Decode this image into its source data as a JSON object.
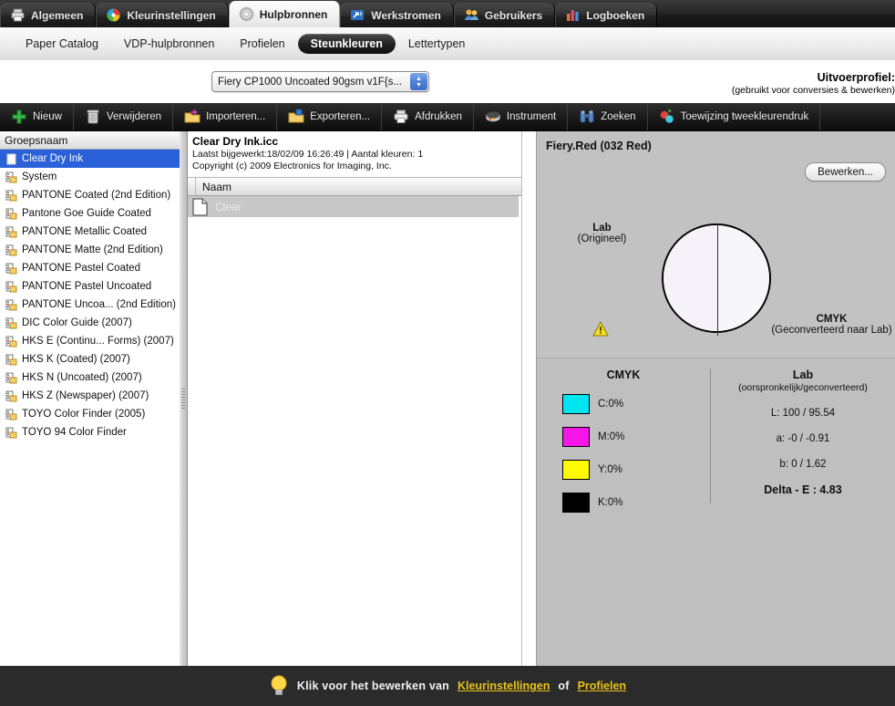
{
  "tabs": [
    {
      "label": "Algemeen",
      "icon": "printer-icon",
      "active": false
    },
    {
      "label": "Kleurinstellingen",
      "icon": "color-wheel-icon",
      "active": false
    },
    {
      "label": "Hulpbronnen",
      "icon": "gear-icon",
      "active": true
    },
    {
      "label": "Werkstromen",
      "icon": "workflow-icon",
      "active": false
    },
    {
      "label": "Gebruikers",
      "icon": "users-icon",
      "active": false
    },
    {
      "label": "Logboeken",
      "icon": "chart-bars-icon",
      "active": false
    }
  ],
  "subtabs": [
    {
      "label": "Paper Catalog",
      "active": false
    },
    {
      "label": "VDP-hulpbronnen",
      "active": false
    },
    {
      "label": "Profielen",
      "active": false
    },
    {
      "label": "Steunkleuren",
      "active": true
    },
    {
      "label": "Lettertypen",
      "active": false
    }
  ],
  "profile": {
    "label": "Uitvoerprofiel:",
    "sublabel": "(gebruikt voor conversies & bewerken)",
    "value": "Fiery CP1000 Uncoated 90gsm v1F{s..."
  },
  "toolbar": [
    {
      "label": "Nieuw",
      "icon": "plus-icon"
    },
    {
      "label": "Verwijderen",
      "icon": "trash-icon"
    },
    {
      "label": "Importeren...",
      "icon": "import-folder-icon"
    },
    {
      "label": "Exporteren...",
      "icon": "export-folder-icon"
    },
    {
      "label": "Afdrukken",
      "icon": "printer-icon"
    },
    {
      "label": "Instrument",
      "icon": "instrument-icon"
    },
    {
      "label": "Zoeken",
      "icon": "binoculars-icon"
    },
    {
      "label": "Toewijzing tweekleurendruk",
      "icon": "two-color-icon"
    }
  ],
  "sidebar": {
    "header": "Groepsnaam",
    "items": [
      {
        "label": "Clear Dry Ink",
        "icon": "swatch-icon",
        "selected": true
      },
      {
        "label": "System",
        "icon": "group-icon",
        "selected": false
      },
      {
        "label": "PANTONE Coated (2nd Edition)",
        "icon": "group-icon",
        "selected": false
      },
      {
        "label": "Pantone Goe Guide Coated",
        "icon": "group-icon",
        "selected": false
      },
      {
        "label": "PANTONE Metallic Coated",
        "icon": "group-icon",
        "selected": false
      },
      {
        "label": "PANTONE Matte (2nd Edition)",
        "icon": "group-icon",
        "selected": false
      },
      {
        "label": "PANTONE Pastel Coated",
        "icon": "group-icon",
        "selected": false
      },
      {
        "label": "PANTONE Pastel Uncoated",
        "icon": "group-icon",
        "selected": false
      },
      {
        "label": "PANTONE Uncoa... (2nd Edition)",
        "icon": "group-icon",
        "selected": false
      },
      {
        "label": "DIC Color Guide (2007)",
        "icon": "group-icon",
        "selected": false
      },
      {
        "label": "HKS E (Continu... Forms) (2007)",
        "icon": "group-icon",
        "selected": false
      },
      {
        "label": "HKS K (Coated) (2007)",
        "icon": "group-icon",
        "selected": false
      },
      {
        "label": "HKS N (Uncoated) (2007)",
        "icon": "group-icon",
        "selected": false
      },
      {
        "label": "HKS Z (Newspaper) (2007)",
        "icon": "group-icon",
        "selected": false
      },
      {
        "label": "TOYO Color Finder (2005)",
        "icon": "group-icon",
        "selected": false
      },
      {
        "label": "TOYO 94 Color Finder",
        "icon": "group-icon",
        "selected": false
      }
    ]
  },
  "middle": {
    "title": "Clear Dry Ink.icc",
    "meta": "Laatst bijgewerkt:18/02/09 16:26:49 | Aantal kleuren: 1",
    "copyright": "Copyright (c) 2009 Electronics for Imaging, Inc.",
    "column_header": "Naam",
    "rows": [
      {
        "name": "Clear",
        "icon": "document-icon"
      }
    ]
  },
  "detail": {
    "title": "Fiery.Red (032 Red)",
    "edit_button": "Bewerken...",
    "lab_original_title": "Lab",
    "lab_original_sub": "(Origineel)",
    "cmyk_converted_title": "CMYK",
    "cmyk_converted_sub": "(Geconverteerd naar Lab)",
    "warning_icon": "warning-triangle-icon",
    "swatch_left_color": "#f5f3f9",
    "swatch_right_color": "#f7f6fa",
    "cmyk": {
      "heading": "CMYK",
      "channels": [
        {
          "label": "C:0%",
          "color": "#00e5f2"
        },
        {
          "label": "M:0%",
          "color": "#f716e8"
        },
        {
          "label": "Y:0%",
          "color": "#fffa00"
        },
        {
          "label": "K:0%",
          "color": "#000000"
        }
      ]
    },
    "lab": {
      "heading": "Lab",
      "subheading": "(oorspronkelijk/geconverteerd)",
      "values": [
        "L:  100 / 95.54",
        "a:  -0 / -0.91",
        "b: 0 / 1.62"
      ],
      "delta": "Delta - E :  4.83"
    }
  },
  "status": {
    "icon": "lightbulb-icon",
    "prefix": "Klik voor het bewerken van",
    "link1": "Kleurinstellingen",
    "middle": "of",
    "link2": "Profielen"
  }
}
